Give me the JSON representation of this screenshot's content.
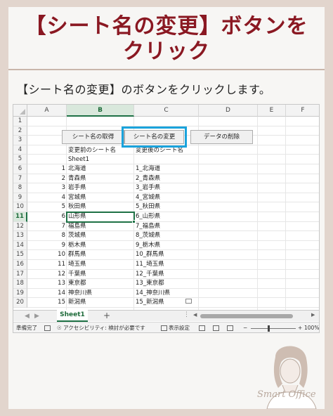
{
  "heading": {
    "line1": "【シート名の変更】ボタンを",
    "line2": "クリック"
  },
  "description": "【シート名の変更】のボタンをクリックします。",
  "excel": {
    "columns": [
      "A",
      "B",
      "C",
      "D",
      "E",
      "F"
    ],
    "selected_column": "B",
    "rows": [
      "1",
      "2",
      "3",
      "4",
      "5",
      "6",
      "7",
      "8",
      "9",
      "10",
      "11",
      "12",
      "13",
      "14",
      "15",
      "16",
      "17",
      "18",
      "19",
      "20"
    ],
    "selected_row": "11",
    "buttons": {
      "get_names": "シート名の取得",
      "change_names": "シート名の変更",
      "delete_data": "データの削除"
    },
    "headers": {
      "before": "変更前のシート名",
      "after": "変更後のシート名"
    },
    "first_sheet": "Sheet1",
    "data_rows": [
      {
        "num": "1",
        "before": "北海道",
        "after": "1_北海道"
      },
      {
        "num": "2",
        "before": "青森県",
        "after": "2_青森県"
      },
      {
        "num": "3",
        "before": "岩手県",
        "after": "3_岩手県"
      },
      {
        "num": "4",
        "before": "宮城県",
        "after": "4_宮城県"
      },
      {
        "num": "5",
        "before": "秋田県",
        "after": "5_秋田県"
      },
      {
        "num": "6",
        "before": "山形県",
        "after": "6_山形県"
      },
      {
        "num": "7",
        "before": "福島県",
        "after": "7_福島県"
      },
      {
        "num": "8",
        "before": "茨城県",
        "after": "8_茨城県"
      },
      {
        "num": "9",
        "before": "栃木県",
        "after": "9_栃木県"
      },
      {
        "num": "10",
        "before": "群馬県",
        "after": "10_群馬県"
      },
      {
        "num": "11",
        "before": "埼玉県",
        "after": "11_埼玉県"
      },
      {
        "num": "12",
        "before": "千葉県",
        "after": "12_千葉県"
      },
      {
        "num": "13",
        "before": "東京都",
        "after": "13_東京都"
      },
      {
        "num": "14",
        "before": "神奈川県",
        "after": "14_神奈川県"
      },
      {
        "num": "15",
        "before": "新潟県",
        "after": "15_新潟県"
      }
    ],
    "sheet_tab": "Sheet1",
    "add_sheet": "+",
    "status": {
      "ready": "準備完了",
      "accessibility": "アクセシビリティ: 検討が必要です",
      "display_settings": "表示設定",
      "zoom_minus": "−",
      "zoom_plus": "+",
      "zoom": "100%"
    }
  },
  "brand": "Smart Office",
  "colors": {
    "title": "#8a1822",
    "highlight": "#1aa3dc",
    "excel_green": "#1e7145",
    "background": "#e2d5cd"
  }
}
